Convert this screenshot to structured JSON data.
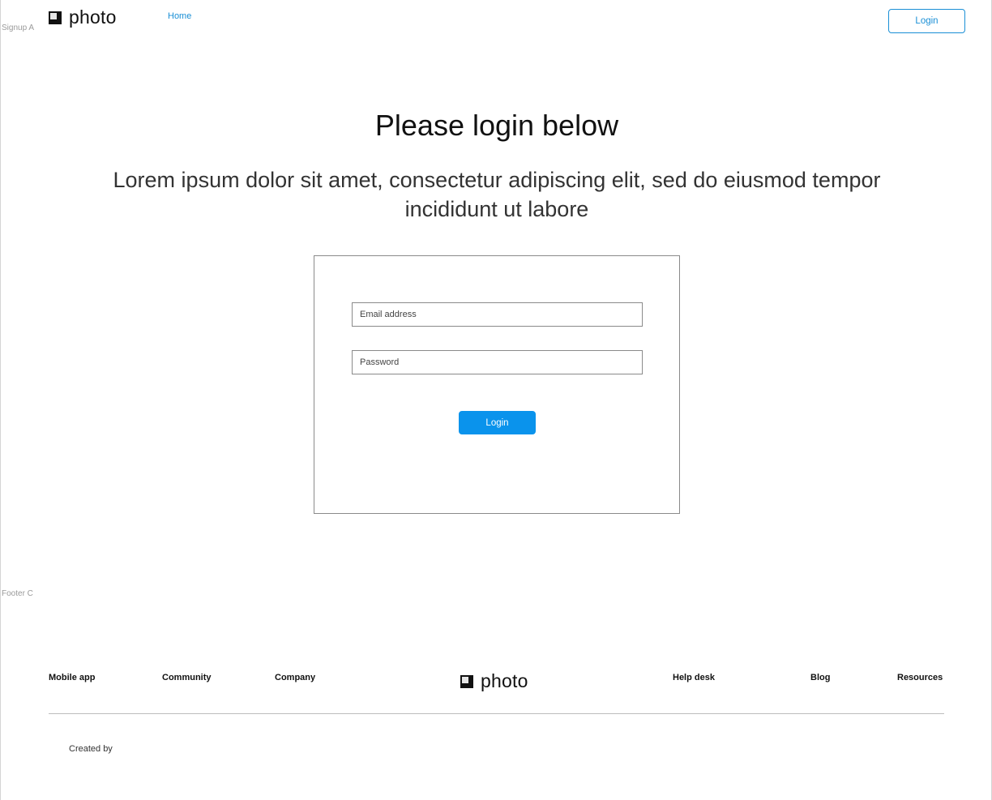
{
  "frame_labels": {
    "signup": "Signup A",
    "footer": "Footer C"
  },
  "brand": {
    "name": "photo",
    "logo_icon": "photo-logo-icon"
  },
  "nav": {
    "home_label": "Home"
  },
  "header": {
    "login_label": "Login"
  },
  "hero": {
    "title": "Please login below",
    "subtitle": "Lorem ipsum dolor sit amet, consectetur adipiscing elit, sed do eiusmod tempor incididunt ut labore"
  },
  "login_form": {
    "email_placeholder": "Email address",
    "password_placeholder": "Password",
    "submit_label": "Login"
  },
  "footer": {
    "links_left": [
      "Mobile app",
      "Community",
      "Company"
    ],
    "links_right": [
      "Help desk",
      "Blog",
      "Resources"
    ],
    "credits": "Created by"
  },
  "colors": {
    "accent": "#0a93ec",
    "link": "#1a8fd6",
    "border": "#8a8a8a"
  }
}
